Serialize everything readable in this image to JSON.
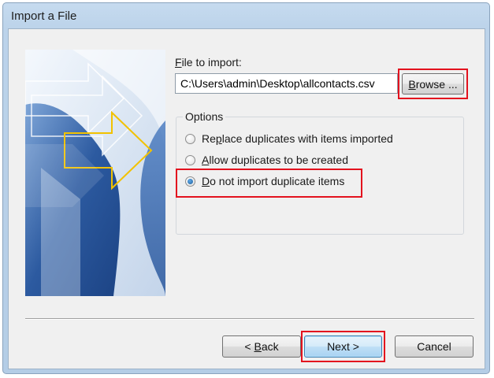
{
  "window": {
    "title": "Import a File"
  },
  "file_to_import": {
    "label_prefix": "",
    "label_accel": "F",
    "label_rest": "ile to import:",
    "value": "C:\\Users\\admin\\Desktop\\allcontacts.csv"
  },
  "browse_button": {
    "accel": "B",
    "rest": "rowse ..."
  },
  "options": {
    "title": "Options",
    "items": [
      {
        "pre": "Re",
        "accel": "p",
        "post": "lace duplicates with items imported",
        "checked": false
      },
      {
        "pre": "",
        "accel": "A",
        "post": "llow duplicates to be created",
        "checked": false
      },
      {
        "pre": "",
        "accel": "D",
        "post": "o not import duplicate items",
        "checked": true
      }
    ]
  },
  "footer": {
    "back_prefix": "< ",
    "back_accel": "B",
    "back_rest": "ack",
    "next_label": "Next >",
    "cancel_label": "Cancel"
  },
  "colors": {
    "highlight": "#e3121e",
    "banner_dark": "#2c5aa0",
    "banner_light": "#dbe8f6",
    "arrow_yellow": "#f2c200"
  },
  "icons": {
    "banner": "import-export-wizard-arrows-graphic"
  }
}
